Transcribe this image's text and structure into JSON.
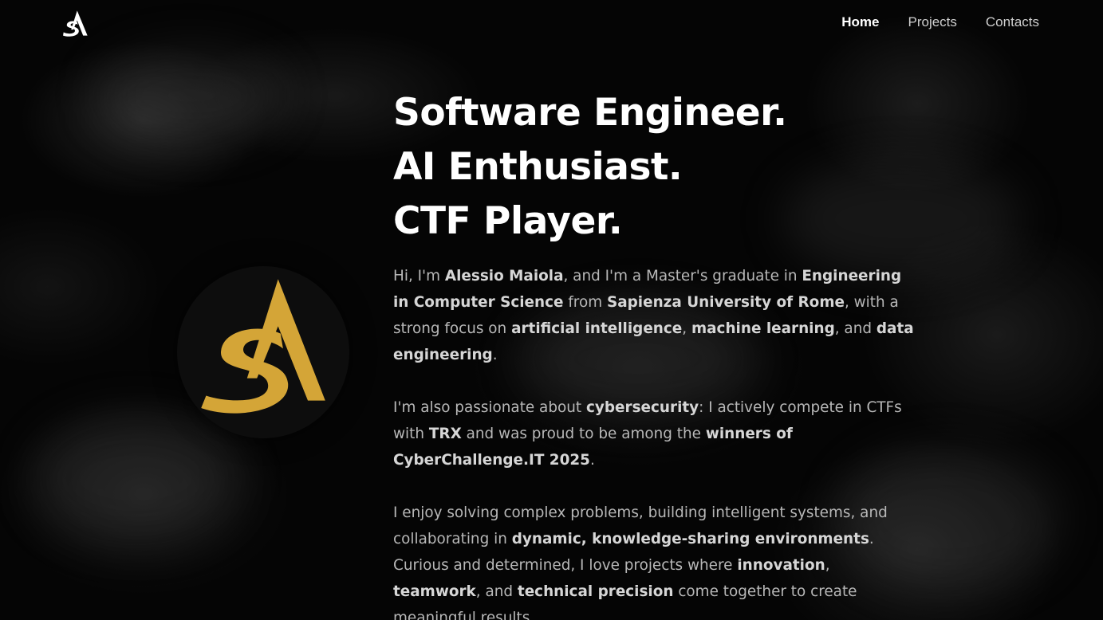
{
  "nav": {
    "logo_text": "SA",
    "items": [
      {
        "label": "Home",
        "active": true
      },
      {
        "label": "Projects",
        "active": false
      },
      {
        "label": "Contacts",
        "active": false
      }
    ]
  },
  "hero": {
    "logo_text": "SA",
    "logo_color": "#d4a537",
    "headline": [
      "Software Engineer.",
      "AI Enthusiast.",
      "CTF Player."
    ]
  },
  "about": {
    "p1": {
      "t1": "Hi, I'm ",
      "b1": "Alessio Maiola",
      "t2": ", and I'm a Master's graduate in ",
      "b2": "Engineering in Computer Science",
      "t3": " from ",
      "b3": "Sapienza University of Rome",
      "t4": ", with a strong focus on ",
      "b4": "artificial intelligence",
      "t5": ", ",
      "b5": "machine learning",
      "t6": ", and ",
      "b6": "data engineering",
      "t7": "."
    },
    "p2": {
      "t1": "I'm also passionate about ",
      "b1": "cybersecurity",
      "t2": ": I actively compete in CTFs with ",
      "b2": "TRX",
      "t3": " and was proud to be among the ",
      "b3": "winners of CyberChallenge.IT 2025",
      "t4": "."
    },
    "p3": {
      "t1": "I enjoy solving complex problems, building intelligent systems, and collaborating in ",
      "b1": "dynamic, knowledge-sharing environments",
      "t2": ". Curious and determined, I love projects where ",
      "b2": "innovation",
      "t3": ", ",
      "b3": "teamwork",
      "t4": ", and ",
      "b4": "technical precision",
      "t5": " come together to create meaningful results."
    }
  },
  "colors": {
    "background": "#050505",
    "text_primary": "#ffffff",
    "text_body": "#b8b8b8",
    "accent_gold": "#d4a537"
  }
}
